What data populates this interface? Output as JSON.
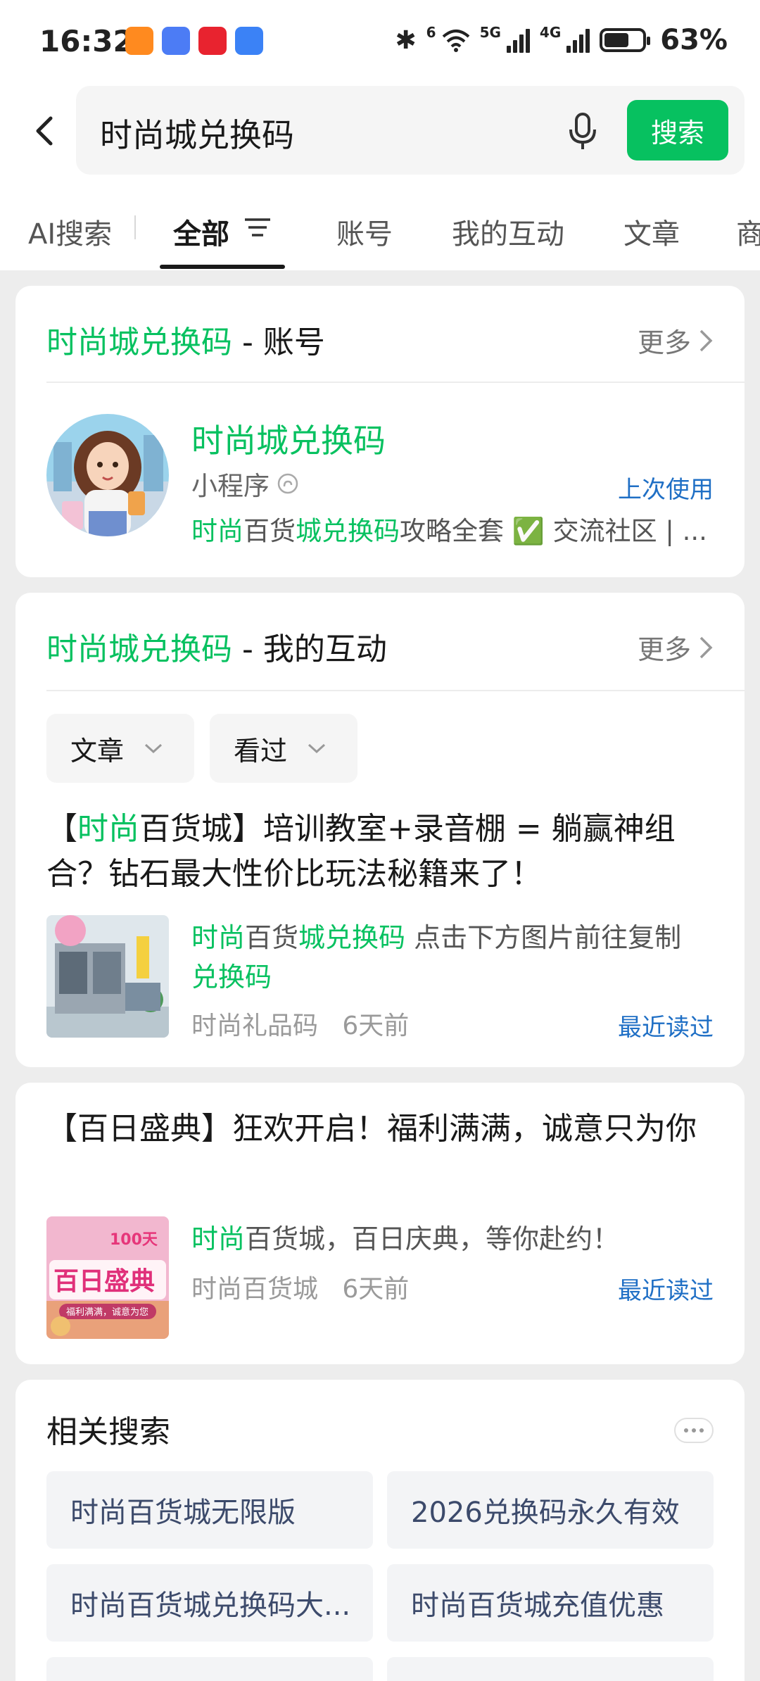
{
  "status_bar": {
    "time": "16:32",
    "battery": "63%",
    "network_1": "5G",
    "network_2": "4G",
    "wifi_tag": "6"
  },
  "search": {
    "query": "时尚城兑换码",
    "button_label": "搜索"
  },
  "tabs": [
    "AI搜索",
    "全部",
    "账号",
    "我的互动",
    "文章",
    "商"
  ],
  "active_tab": "全部",
  "account_section": {
    "title_keyword": "时尚城兑换码",
    "title_suffix": " - 账号",
    "more_label": "更多",
    "account": {
      "name": "时尚城兑换码",
      "type": "小程序",
      "last_used": "上次使用",
      "desc_hl1": "时尚",
      "desc_1": "百货",
      "desc_hl2": "城兑换码",
      "desc_2": "攻略全套 ✅ 交流社区 | ..."
    }
  },
  "interaction_section": {
    "title_keyword": "时尚城兑换码",
    "title_suffix": " - 我的互动",
    "more_label": "更多",
    "filter_1": "文章",
    "filter_2": "看过",
    "article": {
      "title_pre": "【",
      "title_hl": "时尚",
      "title_rest": "百货城】培训教室+录音棚 = 躺赢神组合？钻石最大性价比玩法秘籍来了！",
      "desc_hl1": "时尚",
      "desc_1": "百货",
      "desc_hl2": "城兑换码",
      "desc_2": " 点击下方图片前往复制",
      "desc_hl3": "兑换码",
      "source": "时尚礼品码",
      "time": "6天前",
      "read_status": "最近读过"
    }
  },
  "article2": {
    "title": "【百日盛典】狂欢开启！福利满满，诚意只为你",
    "desc_hl": "时尚",
    "desc_rest": "百货城，百日庆典，等你赴约！",
    "source": "时尚百货城",
    "time": "6天前",
    "read_status": "最近读过",
    "thumb_badge": "100天",
    "thumb_title": "百日盛典",
    "thumb_caption": "福利满满，诚意为您"
  },
  "related": {
    "title": "相关搜索",
    "items": [
      "时尚百货城无限版",
      "2026兑换码永久有效",
      "时尚百货城兑换码大...",
      "时尚百货城充值优惠"
    ]
  },
  "colors": {
    "accent": "#07c160",
    "link_blue": "#1f6fc5",
    "background": "#ededed"
  }
}
